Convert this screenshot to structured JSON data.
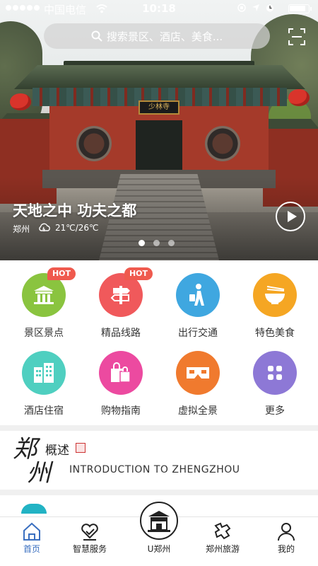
{
  "status_bar": {
    "carrier": "中国电信",
    "time": "10:18"
  },
  "search": {
    "placeholder": "搜索景区、酒店、美食..."
  },
  "hero": {
    "plaque_text": "少林寺",
    "title": "天地之中 功夫之都",
    "city": "郑州",
    "weather": "21℃/26℃",
    "carousel_pages": 3,
    "carousel_active": 1
  },
  "grid": {
    "items": [
      {
        "label": "景区景点",
        "icon": "temple-icon",
        "color": "#8ac43f",
        "hot": "HOT"
      },
      {
        "label": "精品线路",
        "icon": "signpost-icon",
        "color": "#f0595b",
        "hot": "HOT"
      },
      {
        "label": "出行交通",
        "icon": "traveler-icon",
        "color": "#3fa7e0",
        "hot": ""
      },
      {
        "label": "特色美食",
        "icon": "food-bowl-icon",
        "color": "#f5a623",
        "hot": ""
      },
      {
        "label": "酒店住宿",
        "icon": "hotel-buildings-icon",
        "color": "#4fcfc0",
        "hot": ""
      },
      {
        "label": "购物指南",
        "icon": "shopping-bags-icon",
        "color": "#ec4aa0",
        "hot": ""
      },
      {
        "label": "虚拟全景",
        "icon": "vr-glasses-icon",
        "color": "#f07a2e",
        "hot": ""
      },
      {
        "label": "更多",
        "icon": "more-grid-icon",
        "color": "#8d78d6",
        "hot": ""
      }
    ]
  },
  "intro": {
    "calligraphy_top": "郑",
    "calligraphy_bottom": "州",
    "title": "概述",
    "subtitle": "INTRODUCTION TO ZHENGZHOU"
  },
  "tab_bar": {
    "tabs": [
      {
        "label": "首页",
        "icon": "home-icon",
        "active": true
      },
      {
        "label": "智慧服务",
        "icon": "heart-service-icon",
        "active": false
      },
      {
        "label": "U郑州",
        "icon": "city-gate-icon",
        "active": false
      },
      {
        "label": "郑州旅游",
        "icon": "tour-map-icon",
        "active": false
      },
      {
        "label": "我的",
        "icon": "user-icon",
        "active": false
      }
    ]
  },
  "colors": {
    "accent_blue": "#3a6fc0",
    "hot_badge": "#ef5a4e"
  }
}
